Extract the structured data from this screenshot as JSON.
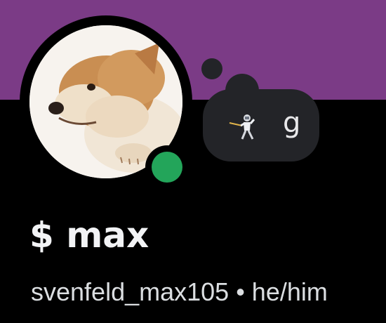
{
  "colors": {
    "banner": "#7b3b86",
    "background": "#000000",
    "online_status": "#23a55a",
    "bubble": "#232428"
  },
  "profile": {
    "avatar_icon": "shiba-dog-avatar",
    "status": "online",
    "custom_status": {
      "emoji_icon": "fencer-icon",
      "text": "g"
    },
    "display_name": "$ max",
    "username": "svenfeld_max105",
    "separator": "•",
    "pronouns": "he/him"
  }
}
